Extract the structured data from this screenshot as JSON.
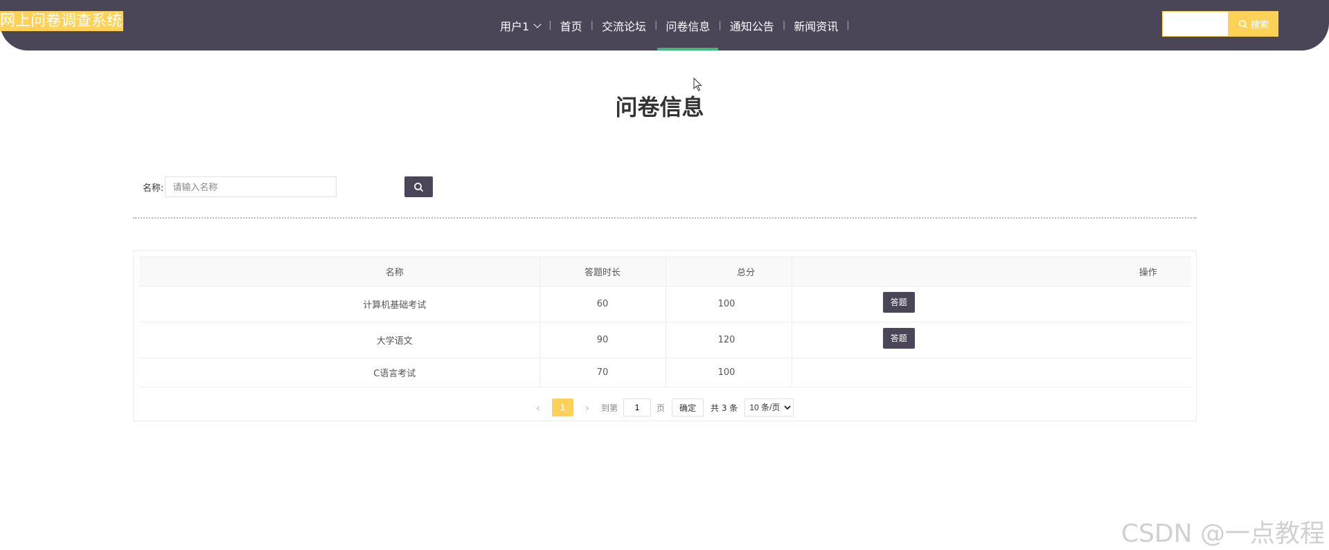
{
  "header": {
    "logo_text": "网上问卷调查系统",
    "nav": [
      {
        "label": "用户1"
      },
      {
        "label": "首页"
      },
      {
        "label": "交流论坛"
      },
      {
        "label": "问卷信息"
      },
      {
        "label": "通知公告"
      },
      {
        "label": "新闻资讯"
      }
    ],
    "active_nav": "问卷信息",
    "search_value": "",
    "search_button_label": "搜索"
  },
  "page": {
    "title": "问卷信息"
  },
  "filter": {
    "label": "名称:",
    "input_placeholder": "请输入名称",
    "input_value": ""
  },
  "table": {
    "columns": [
      "名称",
      "答题时长",
      "总分",
      "操作"
    ],
    "rows": [
      {
        "name": "计算机基础考试",
        "duration": "60",
        "score": "100",
        "action": "答题"
      },
      {
        "name": "大学语文",
        "duration": "90",
        "score": "120",
        "action": "答题"
      },
      {
        "name": "C语言考试",
        "duration": "70",
        "score": "100",
        "action": ""
      }
    ]
  },
  "pagination": {
    "current_page": "1",
    "goto_label": "到第",
    "goto_value": "1",
    "page_unit": "页",
    "confirm_label": "确定",
    "total_text": "共 3 条",
    "page_size_selected": "10 条/页"
  },
  "watermark": "CSDN @一点教程",
  "colors": {
    "header_bg": "#4b4558",
    "accent_yellow": "#ffd257",
    "active_underline": "#43b77a",
    "button_dark": "#4b4558"
  }
}
